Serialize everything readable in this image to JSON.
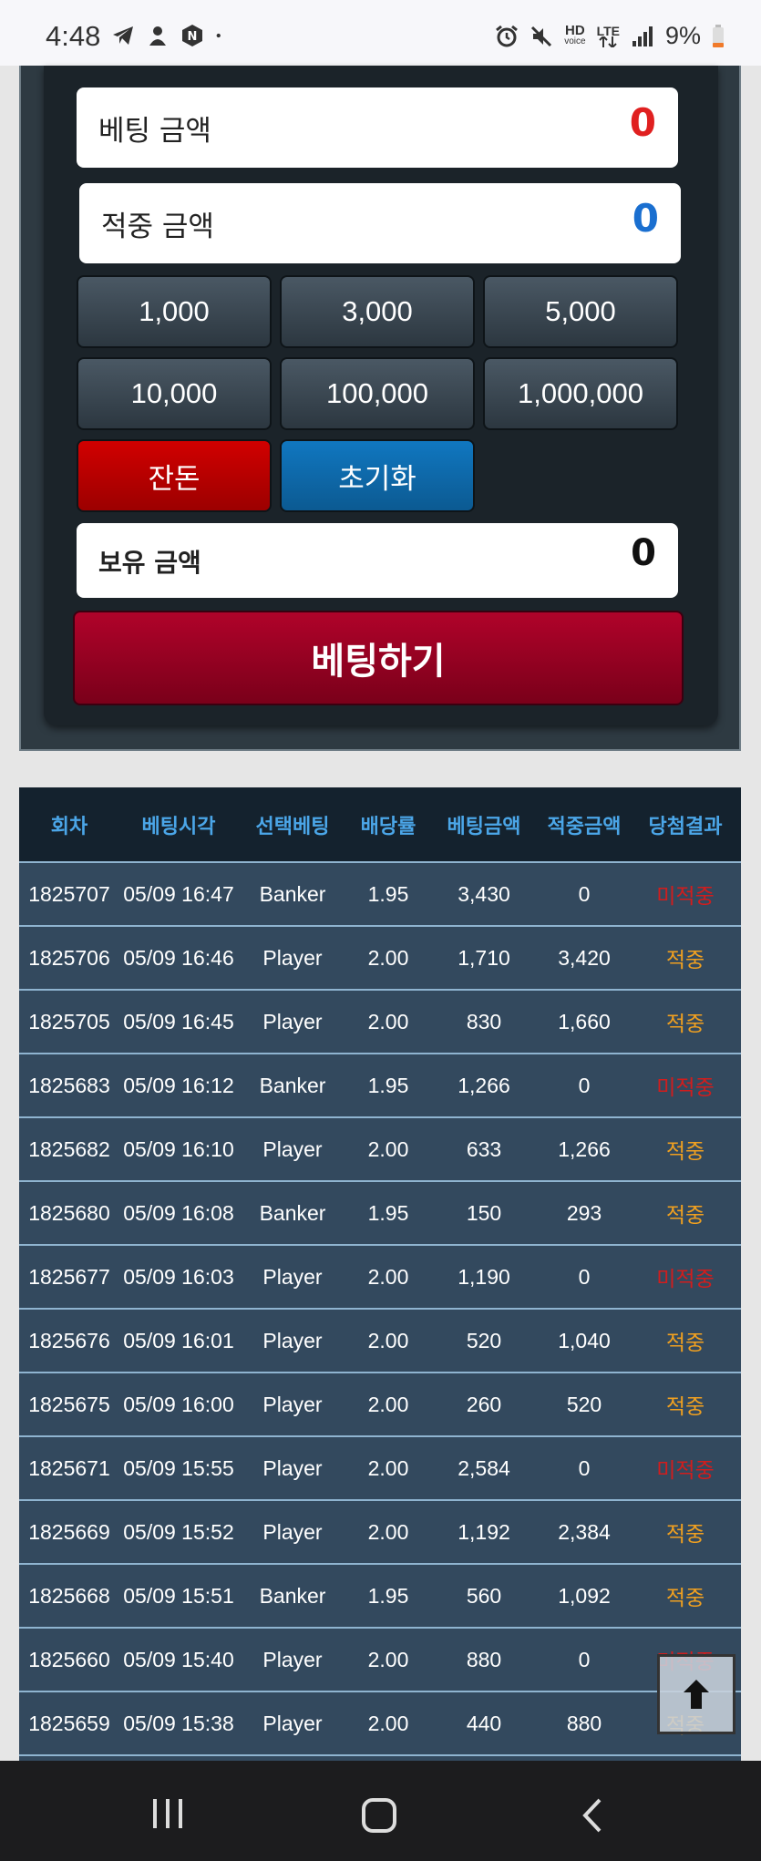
{
  "status": {
    "time": "4:48",
    "network_top": "HD",
    "network_bottom": "voice",
    "lte": "LTE",
    "battery": "9%"
  },
  "bet_form": {
    "bet_amount_label": "베팅 금액",
    "bet_amount_value": "0",
    "win_amount_label": "적중 금액",
    "win_amount_value": "0",
    "chips": [
      "1,000",
      "3,000",
      "5,000",
      "10,000",
      "100,000",
      "1,000,000"
    ],
    "remainder_label": "잔돈",
    "reset_label": "초기화",
    "balance_label": "보유 금액",
    "balance_value": "0",
    "submit_label": "베팅하기",
    "colors": {
      "bet_value": "#e02020",
      "win_value": "#1a6fd0"
    }
  },
  "history": {
    "columns": [
      "회차",
      "베팅시각",
      "선택베팅",
      "배당률",
      "베팅금액",
      "적중금액",
      "당첨결과"
    ],
    "rows": [
      [
        "1825707",
        "05/09 16:47",
        "Banker",
        "1.95",
        "3,430",
        "0",
        "미적중"
      ],
      [
        "1825706",
        "05/09 16:46",
        "Player",
        "2.00",
        "1,710",
        "3,420",
        "적중"
      ],
      [
        "1825705",
        "05/09 16:45",
        "Player",
        "2.00",
        "830",
        "1,660",
        "적중"
      ],
      [
        "1825683",
        "05/09 16:12",
        "Banker",
        "1.95",
        "1,266",
        "0",
        "미적중"
      ],
      [
        "1825682",
        "05/09 16:10",
        "Player",
        "2.00",
        "633",
        "1,266",
        "적중"
      ],
      [
        "1825680",
        "05/09 16:08",
        "Banker",
        "1.95",
        "150",
        "293",
        "적중"
      ],
      [
        "1825677",
        "05/09 16:03",
        "Player",
        "2.00",
        "1,190",
        "0",
        "미적중"
      ],
      [
        "1825676",
        "05/09 16:01",
        "Player",
        "2.00",
        "520",
        "1,040",
        "적중"
      ],
      [
        "1825675",
        "05/09 16:00",
        "Player",
        "2.00",
        "260",
        "520",
        "적중"
      ],
      [
        "1825671",
        "05/09 15:55",
        "Player",
        "2.00",
        "2,584",
        "0",
        "미적중"
      ],
      [
        "1825669",
        "05/09 15:52",
        "Player",
        "2.00",
        "1,192",
        "2,384",
        "적중"
      ],
      [
        "1825668",
        "05/09 15:51",
        "Banker",
        "1.95",
        "560",
        "1,092",
        "적중"
      ],
      [
        "1825660",
        "05/09 15:40",
        "Player",
        "2.00",
        "880",
        "0",
        "미적중"
      ],
      [
        "1825659",
        "05/09 15:38",
        "Player",
        "2.00",
        "440",
        "880",
        "적중"
      ]
    ],
    "colors": {
      "hit": "#f0a020",
      "miss": "#d11d1d",
      "header_text": "#4ba6e8"
    }
  },
  "icons": {
    "scroll_top": "arrow-up-icon",
    "nav": [
      "recents-icon",
      "home-icon",
      "back-icon"
    ]
  }
}
